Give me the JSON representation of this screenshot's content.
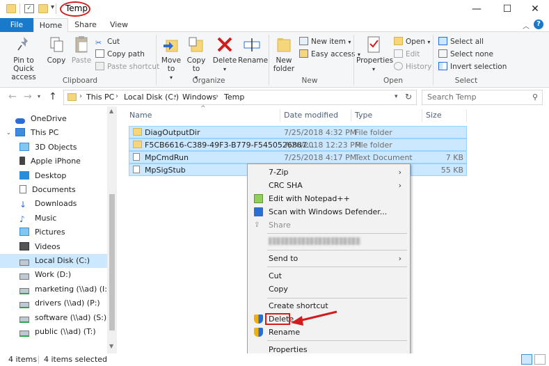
{
  "window": {
    "title": "Temp",
    "minimize": "—",
    "maximize": "☐",
    "close": "✕"
  },
  "tabs": {
    "file": "File",
    "home": "Home",
    "share": "Share",
    "view": "View"
  },
  "ribbon": {
    "clipboard": {
      "label": "Clipboard",
      "pin": "Pin to Quick access",
      "copy": "Copy",
      "paste": "Paste",
      "cut": "Cut",
      "copy_path": "Copy path",
      "paste_shortcut": "Paste shortcut"
    },
    "organize": {
      "label": "Organize",
      "move_to": "Move to",
      "copy_to": "Copy to",
      "delete": "Delete",
      "rename": "Rename"
    },
    "new": {
      "label": "New",
      "new_folder": "New folder",
      "new_item": "New item",
      "easy_access": "Easy access"
    },
    "open": {
      "label": "Open",
      "properties": "Properties",
      "open": "Open",
      "edit": "Edit",
      "history": "History"
    },
    "select": {
      "label": "Select",
      "select_all": "Select all",
      "select_none": "Select none",
      "invert": "Invert selection"
    }
  },
  "address": {
    "crumbs": [
      "This PC",
      "Local Disk (C:)",
      "Windows",
      "Temp"
    ],
    "search_placeholder": "Search Temp"
  },
  "nav": {
    "items": [
      {
        "label": "OneDrive",
        "icon": "cloud-icon",
        "indent": 1
      },
      {
        "label": "This PC",
        "icon": "computer-icon",
        "indent": 1
      },
      {
        "label": "3D Objects",
        "icon": "cube-icon",
        "indent": 2
      },
      {
        "label": "Apple iPhone",
        "icon": "phone-icon",
        "indent": 2
      },
      {
        "label": "Desktop",
        "icon": "desktop-icon",
        "indent": 2
      },
      {
        "label": "Documents",
        "icon": "document-icon",
        "indent": 2
      },
      {
        "label": "Downloads",
        "icon": "download-icon",
        "indent": 2
      },
      {
        "label": "Music",
        "icon": "music-icon",
        "indent": 2
      },
      {
        "label": "Pictures",
        "icon": "pictures-icon",
        "indent": 2
      },
      {
        "label": "Videos",
        "icon": "video-icon",
        "indent": 2
      },
      {
        "label": "Local Disk (C:)",
        "icon": "drive-icon",
        "indent": 2,
        "selected": true
      },
      {
        "label": "Work (D:)",
        "icon": "drive-icon",
        "indent": 2
      },
      {
        "label": "marketing (\\\\ad) (I:)",
        "icon": "network-drive-icon",
        "indent": 2
      },
      {
        "label": "drivers (\\\\ad) (P:)",
        "icon": "network-drive-icon",
        "indent": 2
      },
      {
        "label": "software (\\\\ad) (S:)",
        "icon": "network-drive-icon",
        "indent": 2
      },
      {
        "label": "public (\\\\ad) (T:)",
        "icon": "network-drive-icon",
        "indent": 2
      }
    ]
  },
  "columns": {
    "name": "Name",
    "date": "Date modified",
    "type": "Type",
    "size": "Size"
  },
  "files": [
    {
      "name": "DiagOutputDir",
      "date": "7/25/2018 4:32 PM",
      "type": "File folder",
      "size": "",
      "icon": "folder-icon"
    },
    {
      "name": "F5CB6616-C389-49F3-B779-F5450526887...",
      "date": "7/26/2018 12:23 PM",
      "type": "File folder",
      "size": "",
      "icon": "folder-icon"
    },
    {
      "name": "MpCmdRun",
      "date": "7/25/2018 4:17 PM",
      "type": "Text Document",
      "size": "7 KB",
      "icon": "text-file-icon"
    },
    {
      "name": "MpSigStub",
      "date": "",
      "type": "",
      "size": "55 KB",
      "icon": "text-file-icon"
    }
  ],
  "context_menu": {
    "zip": "7-Zip",
    "crc": "CRC SHA",
    "notepad": "Edit with Notepad++",
    "defender": "Scan with Windows Defender...",
    "share": "Share",
    "send_to": "Send to",
    "cut": "Cut",
    "copy": "Copy",
    "create_shortcut": "Create shortcut",
    "delete": "Delete",
    "rename": "Rename",
    "properties": "Properties"
  },
  "status": {
    "items": "4 items",
    "selected": "4 items selected"
  },
  "colors": {
    "accent": "#1979ca",
    "selection": "#cce8ff",
    "highlight": "#d21c1c"
  }
}
